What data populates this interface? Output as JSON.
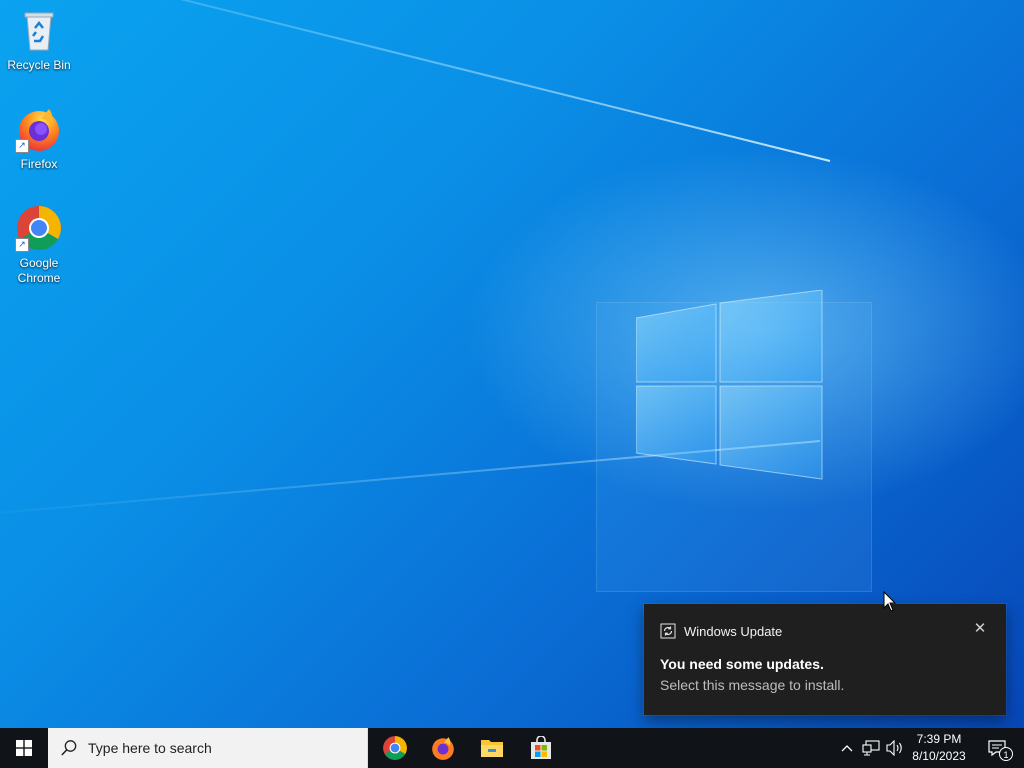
{
  "desktop": {
    "icons": [
      {
        "label": "Recycle Bin",
        "icon": "recycle-bin-icon"
      },
      {
        "label": "Firefox",
        "icon": "firefox-icon"
      },
      {
        "label": "Google Chrome",
        "icon": "chrome-icon"
      }
    ]
  },
  "toast": {
    "app_name": "Windows Update",
    "app_icon": "refresh-icon",
    "title": "You need some updates.",
    "body": "Select this message to install.",
    "close_glyph": "✕"
  },
  "taskbar": {
    "search_placeholder": "Type here to search",
    "pinned_apps": [
      "Google Chrome",
      "Firefox",
      "File Explorer",
      "Microsoft Store"
    ],
    "tray": {
      "time": "7:39 PM",
      "date": "8/10/2023",
      "notification_count": "1"
    }
  },
  "colors": {
    "taskbar_bg": "#101318",
    "toast_bg": "#1f1f1f",
    "desktop_accent": "#0a8fe6"
  }
}
